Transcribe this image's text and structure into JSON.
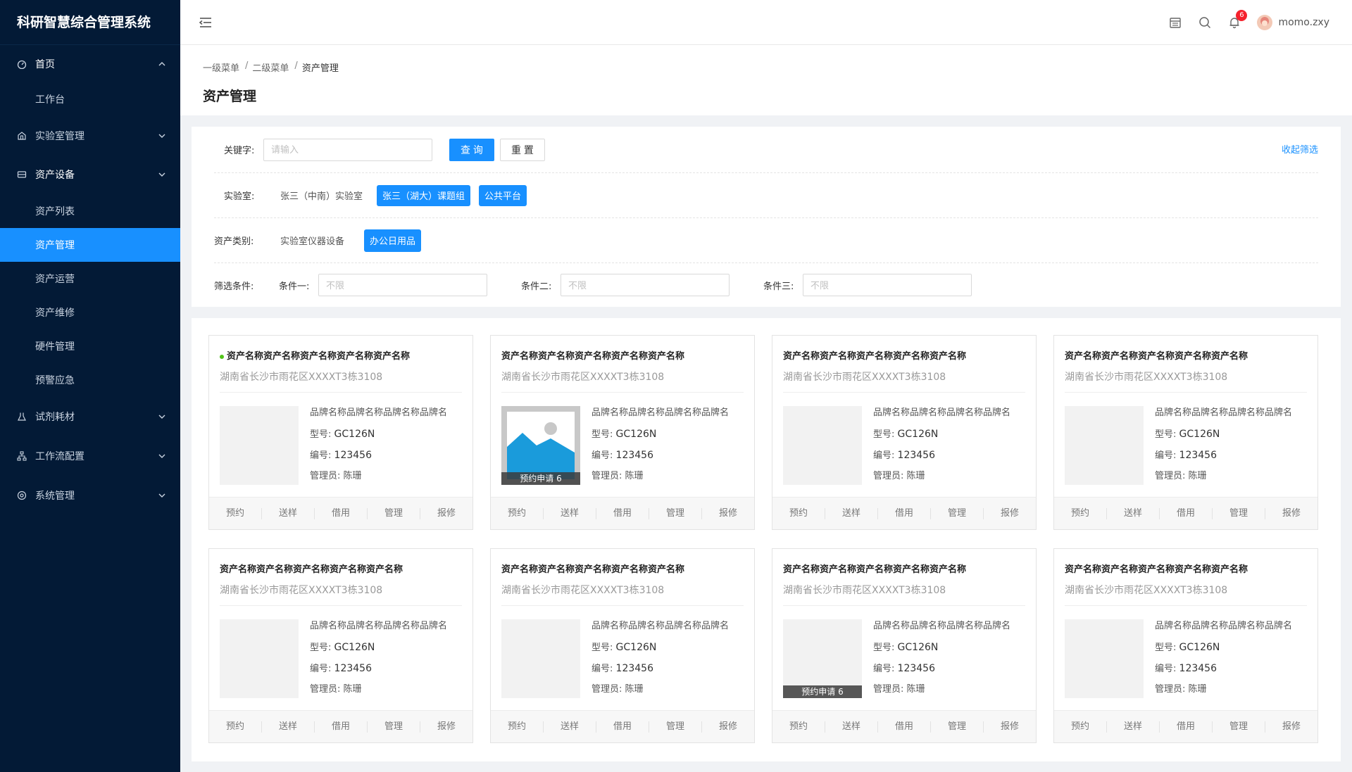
{
  "app_title": "科研智慧综合管理系统",
  "sidebar": {
    "items": [
      {
        "label": "首页",
        "icon": "dashboard-icon",
        "open": true,
        "children": [
          "工作台"
        ]
      },
      {
        "label": "实验室管理",
        "icon": "lab-icon",
        "open": false
      },
      {
        "label": "资产设备",
        "icon": "box-icon",
        "open": true,
        "children": [
          "资产列表",
          "资产管理",
          "资产运营",
          "资产维修",
          "硬件管理",
          "预警应急"
        ]
      },
      {
        "label": "试剂耗材",
        "icon": "flask-icon",
        "open": false
      },
      {
        "label": "工作流配置",
        "icon": "workflow-icon",
        "open": false
      },
      {
        "label": "系统管理",
        "icon": "settings-icon",
        "open": false
      }
    ],
    "active_item": "资产管理"
  },
  "header": {
    "notification_count": "6",
    "username": "momo.zxy"
  },
  "breadcrumb": [
    "一级菜单",
    "二级菜单",
    "资产管理"
  ],
  "breadcrumb_sep": "/",
  "page_title": "资产管理",
  "filter": {
    "keyword_label": "关键字:",
    "keyword_placeholder": "请输入",
    "query_button": "查 询",
    "reset_button": "重 置",
    "collapse_link": "收起筛选",
    "lab_label": "实验室:",
    "lab_options": [
      "张三（中南）实验室",
      "张三（湖大）课题组",
      "公共平台"
    ],
    "lab_selected": [
      1,
      2
    ],
    "category_label": "资产类别:",
    "category_options": [
      "实验室仪器设备",
      "办公日用品"
    ],
    "category_selected": [
      1
    ],
    "conditions_label": "筛选条件:",
    "condition1_label": "条件一:",
    "condition2_label": "条件二:",
    "condition3_label": "条件三:",
    "condition_placeholder": "不限"
  },
  "cards": {
    "title": "资产名称资产名称资产名称资产名称资产名称",
    "address": "湖南省长沙市雨花区XXXXT3栋3108",
    "brand": "品牌名称品牌名称品牌名称品牌名",
    "model_label": "型号:",
    "model": "GC126N",
    "number_label": "编号:",
    "number": "123456",
    "manager_label": "管理员:",
    "manager": "陈珊",
    "reserve_badge": "预约申请 6",
    "actions": [
      "预约",
      "送样",
      "借用",
      "管理",
      "报修"
    ],
    "items": [
      {
        "status_dot": true,
        "photo": false,
        "badge": false
      },
      {
        "status_dot": false,
        "photo": true,
        "badge": true
      },
      {
        "status_dot": false,
        "photo": false,
        "badge": false
      },
      {
        "status_dot": false,
        "photo": false,
        "badge": false
      },
      {
        "status_dot": false,
        "photo": false,
        "badge": false
      },
      {
        "status_dot": false,
        "photo": false,
        "badge": false
      },
      {
        "status_dot": false,
        "photo": false,
        "badge": true
      },
      {
        "status_dot": false,
        "photo": false,
        "badge": false
      }
    ]
  },
  "colors": {
    "sidebar_bg": "#031a36",
    "primary": "#1890ff",
    "status_green": "#52c41a",
    "badge_red": "#f5222d"
  }
}
